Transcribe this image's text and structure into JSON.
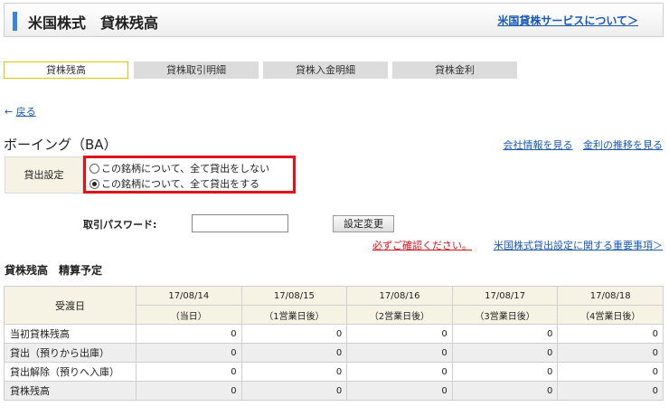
{
  "header": {
    "title": "米国株式　貸株残高",
    "about_link": "米国貸株サービスについて＞"
  },
  "tabs": [
    {
      "label": "貸株残高",
      "active": true
    },
    {
      "label": "貸株取引明細",
      "active": false
    },
    {
      "label": "貸株入金明細",
      "active": false
    },
    {
      "label": "貸株金利",
      "active": false
    }
  ],
  "back": {
    "arrow": "←",
    "label": "戻る"
  },
  "stock": {
    "name": "ボーイング（BA）"
  },
  "links": {
    "company_info": "会社情報を見る",
    "rate_history": "金利の推移を見る"
  },
  "lending": {
    "label": "貸出設定",
    "options": [
      {
        "label": "この銘柄について、全て貸出をしない",
        "selected": false
      },
      {
        "label": "この銘柄について、全て貸出をする",
        "selected": true
      }
    ]
  },
  "password": {
    "label": "取引パスワード:",
    "value": "",
    "button": "設定変更"
  },
  "notices": {
    "confirm": "必ずご確認ください。",
    "important": "米国株式貸出設定に関する重要事項＞"
  },
  "section_title": "貸株残高　精算予定",
  "table": {
    "corner_label": "受渡日",
    "dates": [
      "17/08/14",
      "17/08/15",
      "17/08/16",
      "17/08/17",
      "17/08/18"
    ],
    "day_labels": [
      "（当日）",
      "（1営業日後）",
      "（2営業日後）",
      "（3営業日後）",
      "（4営業日後）"
    ],
    "rows": [
      {
        "label": "当初貸株残高",
        "values": [
          "0",
          "0",
          "0",
          "0",
          "0"
        ]
      },
      {
        "label": "貸出（預りから出庫）",
        "values": [
          "0",
          "0",
          "0",
          "0",
          "0"
        ]
      },
      {
        "label": "貸出解除（預りへ入庫）",
        "values": [
          "0",
          "0",
          "0",
          "0",
          "0"
        ]
      },
      {
        "label": "貸株残高",
        "values": [
          "0",
          "0",
          "0",
          "0",
          "0"
        ]
      }
    ]
  }
}
